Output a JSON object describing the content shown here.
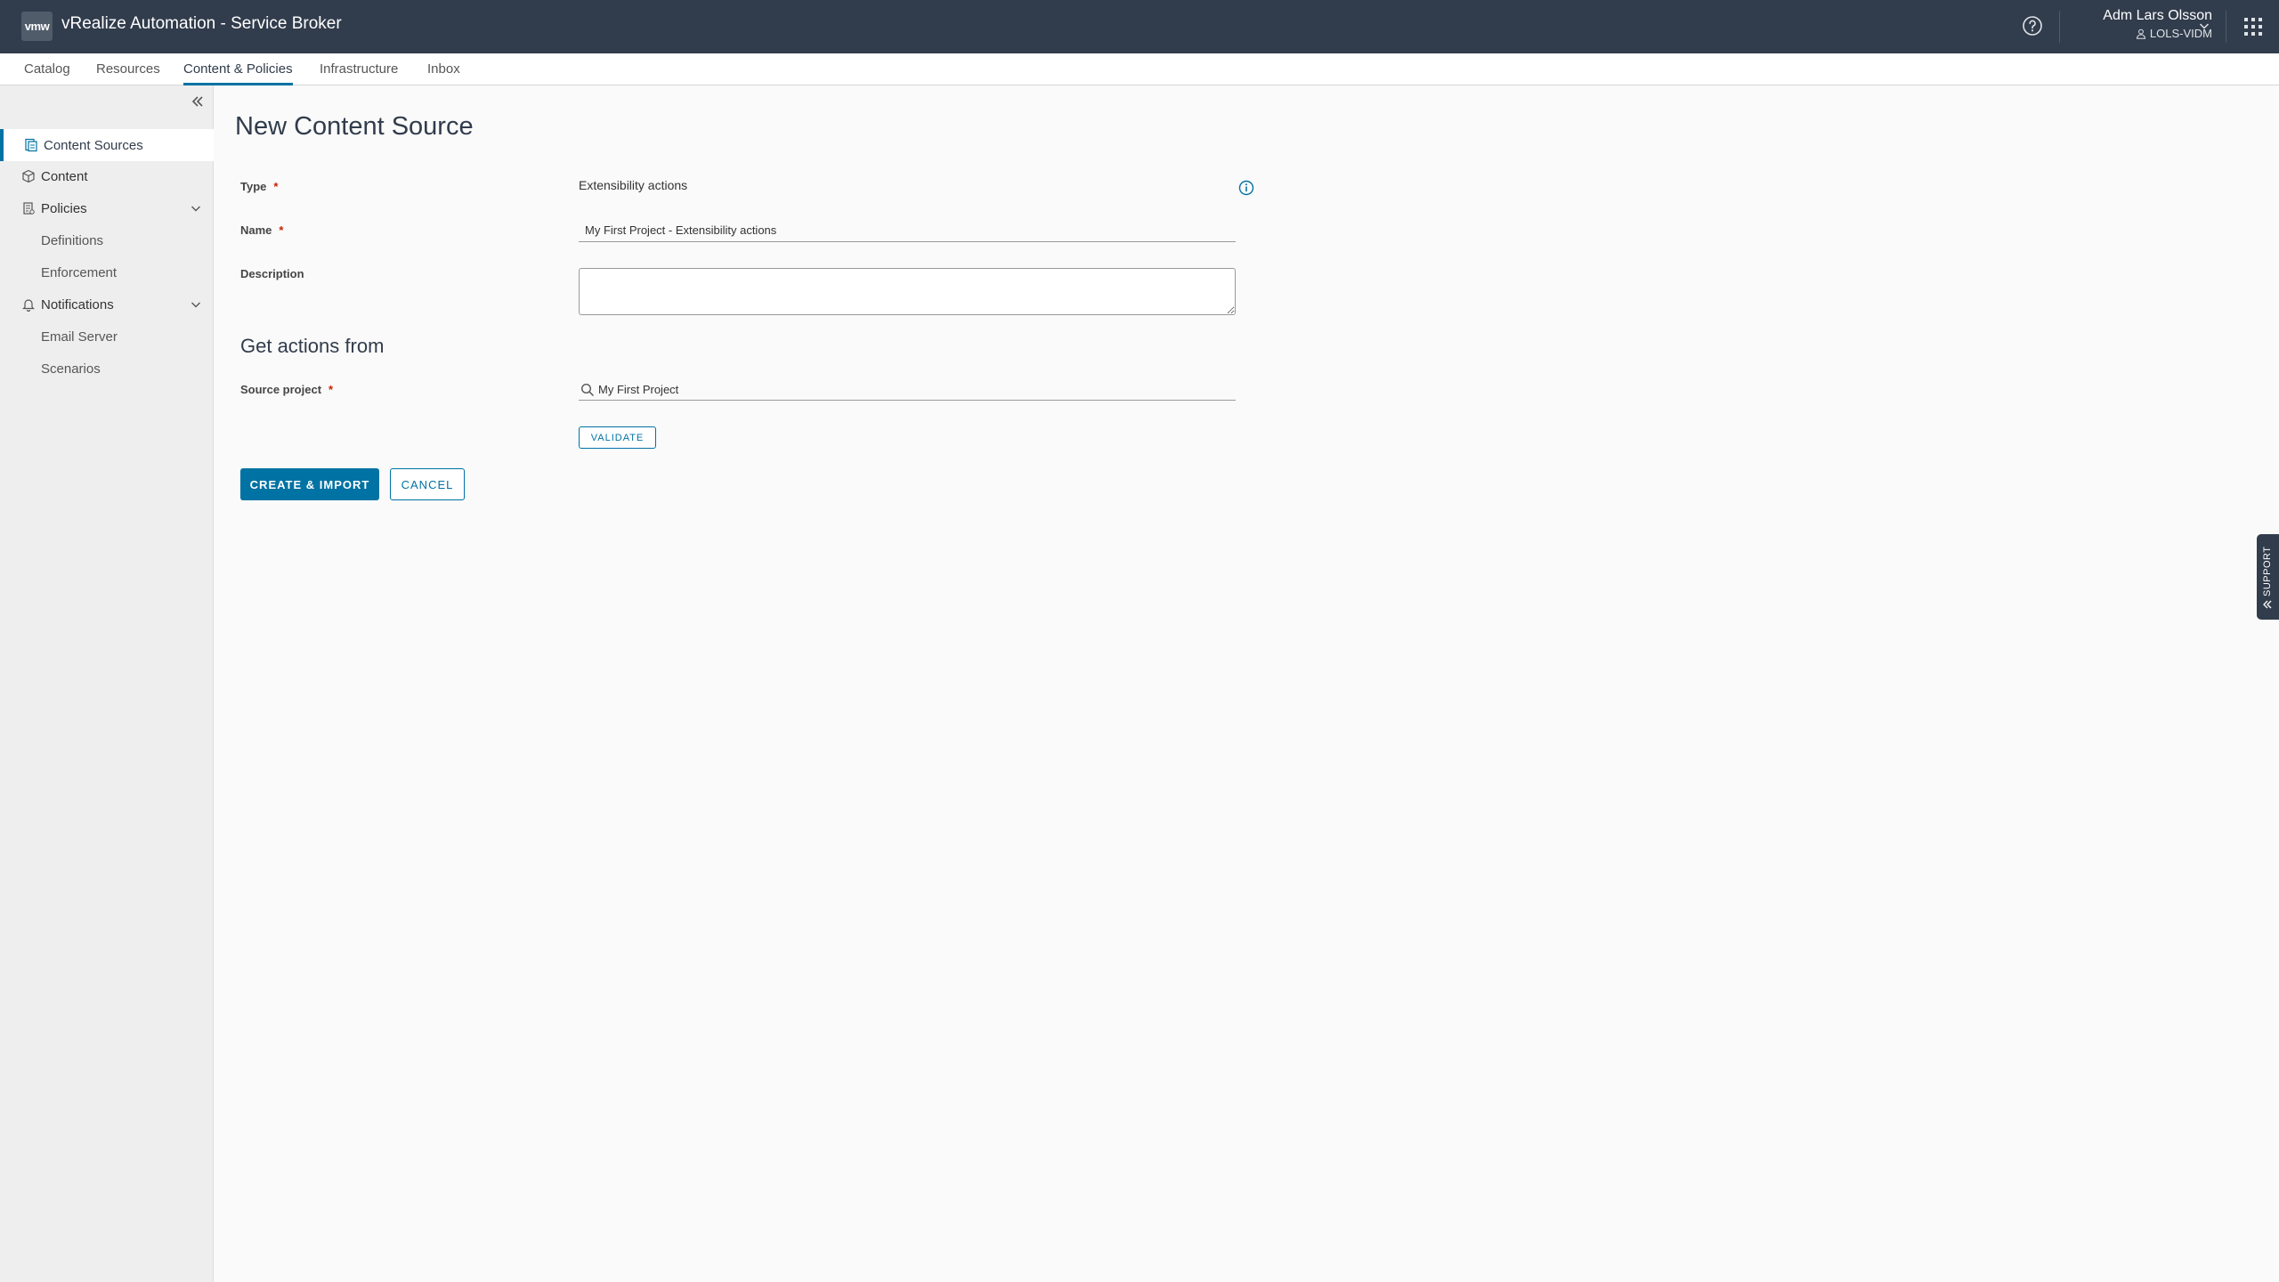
{
  "header": {
    "logo_text": "vmw",
    "app_title": "vRealize Automation - Service Broker",
    "user_name": "Adm Lars Olsson",
    "user_tenant": "LOLS-VIDM",
    "icons": [
      "help-icon",
      "user-icon",
      "chevron-down-icon",
      "apps-grid-icon"
    ]
  },
  "nav": {
    "tabs": [
      {
        "label": "Catalog",
        "active": false
      },
      {
        "label": "Resources",
        "active": false
      },
      {
        "label": "Content & Policies",
        "active": true
      },
      {
        "label": "Infrastructure",
        "active": false
      },
      {
        "label": "Inbox",
        "active": false
      }
    ]
  },
  "sidebar": {
    "items": [
      {
        "label": "Content Sources",
        "icon": "content-sources-icon",
        "active": true
      },
      {
        "label": "Content",
        "icon": "cube-icon",
        "active": false
      },
      {
        "label": "Policies",
        "icon": "policy-icon",
        "expanded": true,
        "children": [
          "Definitions",
          "Enforcement"
        ]
      },
      {
        "label": "Notifications",
        "icon": "bell-icon",
        "expanded": true,
        "children": [
          "Email Server",
          "Scenarios"
        ]
      }
    ]
  },
  "form": {
    "title": "New Content Source",
    "type_label": "Type",
    "type_value": "Extensibility actions",
    "name_label": "Name",
    "name_value": "My First Project - Extensibility actions",
    "description_label": "Description",
    "description_value": "",
    "section_title": "Get actions from",
    "source_project_label": "Source project",
    "source_project_value": "My First Project",
    "validate_label": "VALIDATE",
    "create_label": "CREATE & IMPORT",
    "cancel_label": "CANCEL",
    "required_mark": "*"
  },
  "support": {
    "label": "SUPPORT"
  },
  "colors": {
    "header_bg": "#313c4c",
    "accent": "#0072a3",
    "required": "#c92100",
    "sidebar_bg": "#eeeeee",
    "page_bg": "#fafafa"
  }
}
